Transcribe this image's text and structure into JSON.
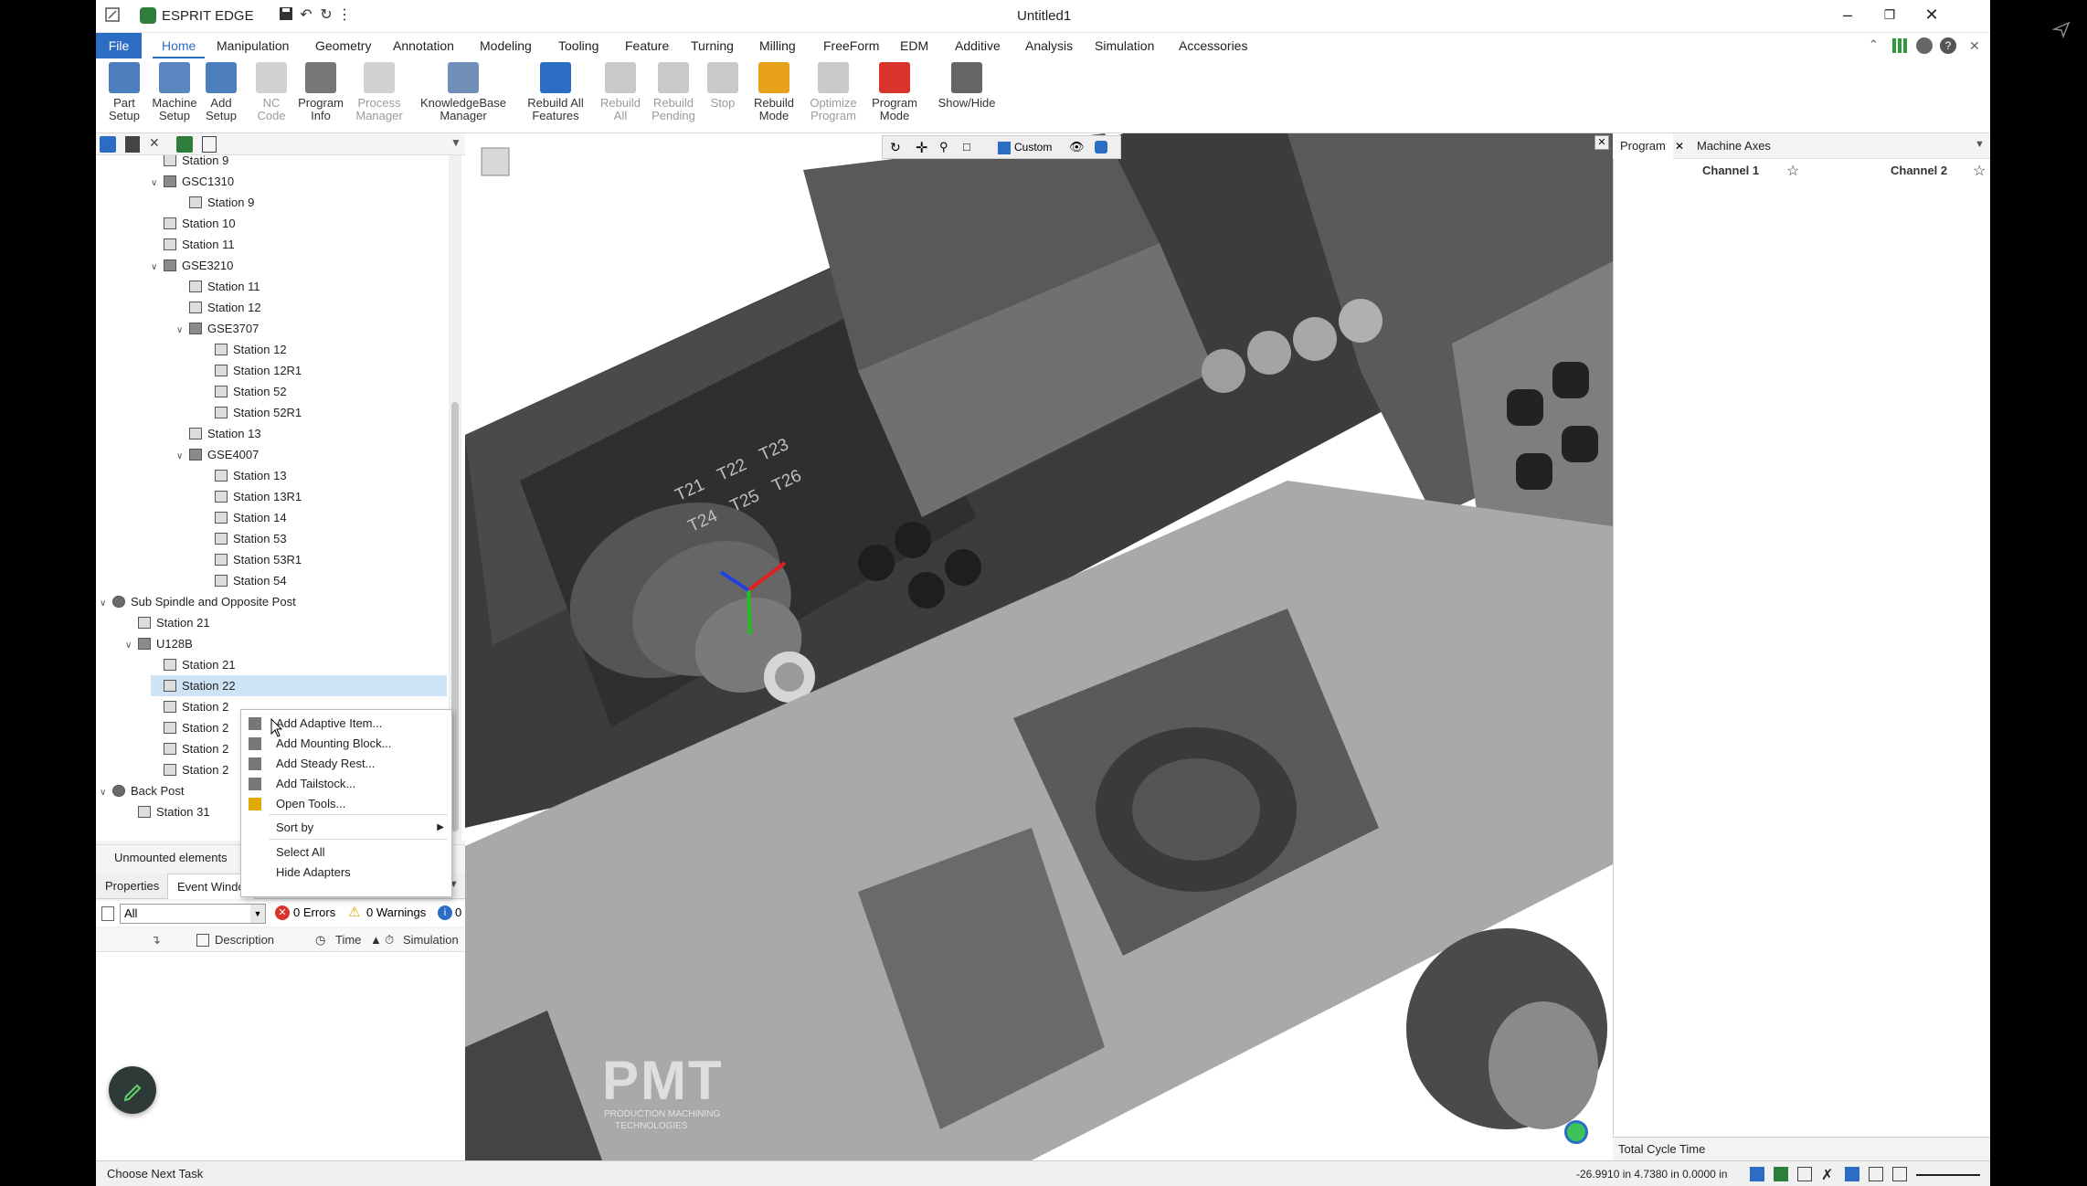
{
  "app": {
    "name": "ESPRIT EDGE",
    "document_title": "Untitled1"
  },
  "ribbon_tabs": [
    "File",
    "Home",
    "Manipulation",
    "Geometry",
    "Annotation",
    "Modeling",
    "Tooling",
    "Feature",
    "Turning",
    "Milling",
    "FreeForm",
    "EDM",
    "Additive",
    "Analysis",
    "Simulation",
    "Accessories"
  ],
  "active_tab": "Home",
  "ribbon_buttons": [
    {
      "line1": "Part",
      "line2": "Setup",
      "enabled": true,
      "icon": "part-setup-icon"
    },
    {
      "line1": "Machine",
      "line2": "Setup",
      "enabled": true,
      "icon": "machine-setup-icon"
    },
    {
      "line1": "Add",
      "line2": "Setup",
      "enabled": true,
      "icon": "add-setup-icon"
    },
    {
      "line1": "NC",
      "line2": "Code",
      "enabled": false,
      "icon": "nc-code-icon"
    },
    {
      "line1": "Program",
      "line2": "Info",
      "enabled": true,
      "icon": "program-info-icon"
    },
    {
      "line1": "Process",
      "line2": "Manager",
      "enabled": false,
      "icon": "process-manager-icon"
    },
    {
      "line1": "KnowledgeBase",
      "line2": "Manager",
      "enabled": true,
      "icon": "knowledgebase-icon"
    },
    {
      "line1": "Rebuild All",
      "line2": "Features",
      "enabled": true,
      "icon": "rebuild-all-features-icon"
    },
    {
      "line1": "Rebuild",
      "line2": "All",
      "enabled": false,
      "icon": "rebuild-all-icon"
    },
    {
      "line1": "Rebuild",
      "line2": "Pending",
      "enabled": false,
      "icon": "rebuild-pending-icon"
    },
    {
      "line1": "Stop",
      "line2": "",
      "enabled": false,
      "icon": "stop-icon"
    },
    {
      "line1": "Rebuild",
      "line2": "Mode",
      "enabled": true,
      "icon": "rebuild-mode-icon"
    },
    {
      "line1": "Optimize",
      "line2": "Program",
      "enabled": false,
      "icon": "optimize-program-icon"
    },
    {
      "line1": "Program",
      "line2": "Mode",
      "enabled": true,
      "icon": "program-mode-icon"
    },
    {
      "line1": "Show/Hide",
      "line2": "",
      "enabled": true,
      "icon": "show-hide-icon"
    }
  ],
  "tree": {
    "nodes": [
      {
        "label": "Station 9",
        "level": 2,
        "chev": "",
        "type": "station"
      },
      {
        "label": "GSC1310",
        "level": 2,
        "chev": "v",
        "type": "adapter"
      },
      {
        "label": "Station 9",
        "level": 3,
        "chev": "",
        "type": "station"
      },
      {
        "label": "Station 10",
        "level": 2,
        "chev": "",
        "type": "station"
      },
      {
        "label": "Station 11",
        "level": 2,
        "chev": "",
        "type": "station"
      },
      {
        "label": "GSE3210",
        "level": 2,
        "chev": "v",
        "type": "adapter"
      },
      {
        "label": "Station 11",
        "level": 3,
        "chev": "",
        "type": "station"
      },
      {
        "label": "Station 12",
        "level": 3,
        "chev": "",
        "type": "station"
      },
      {
        "label": "GSE3707",
        "level": 3,
        "chev": "v",
        "type": "adapter"
      },
      {
        "label": "Station 12",
        "level": 4,
        "chev": "",
        "type": "station"
      },
      {
        "label": "Station 12R1",
        "level": 4,
        "chev": "",
        "type": "station"
      },
      {
        "label": "Station 52",
        "level": 4,
        "chev": "",
        "type": "station"
      },
      {
        "label": "Station 52R1",
        "level": 4,
        "chev": "",
        "type": "station"
      },
      {
        "label": "Station 13",
        "level": 3,
        "chev": "",
        "type": "station"
      },
      {
        "label": "GSE4007",
        "level": 3,
        "chev": "v",
        "type": "adapter"
      },
      {
        "label": "Station 13",
        "level": 4,
        "chev": "",
        "type": "station"
      },
      {
        "label": "Station 13R1",
        "level": 4,
        "chev": "",
        "type": "station"
      },
      {
        "label": "Station 14",
        "level": 4,
        "chev": "",
        "type": "station"
      },
      {
        "label": "Station 53",
        "level": 4,
        "chev": "",
        "type": "station"
      },
      {
        "label": "Station 53R1",
        "level": 4,
        "chev": "",
        "type": "station"
      },
      {
        "label": "Station 54",
        "level": 4,
        "chev": "",
        "type": "station"
      },
      {
        "label": "Sub Spindle and Opposite Post",
        "level": 0,
        "chev": "v",
        "type": "post"
      },
      {
        "label": "Station 21",
        "level": 1,
        "chev": "",
        "type": "station"
      },
      {
        "label": "U128B",
        "level": 1,
        "chev": "v",
        "type": "adapter"
      },
      {
        "label": "Station 21",
        "level": 2,
        "chev": "",
        "type": "station"
      },
      {
        "label": "Station 22",
        "level": 2,
        "chev": "",
        "type": "station",
        "selected": true
      },
      {
        "label": "Station 2",
        "level": 2,
        "chev": "",
        "type": "station"
      },
      {
        "label": "Station 2",
        "level": 2,
        "chev": "",
        "type": "station"
      },
      {
        "label": "Station 2",
        "level": 2,
        "chev": "",
        "type": "station"
      },
      {
        "label": "Station 2",
        "level": 2,
        "chev": "",
        "type": "station"
      },
      {
        "label": "Back Post",
        "level": 0,
        "chev": "v",
        "type": "post"
      },
      {
        "label": "Station 31",
        "level": 1,
        "chev": "",
        "type": "station"
      }
    ]
  },
  "unmounted_label": "Unmounted elements",
  "bottom_tabs": [
    "Properties",
    "Event Windo"
  ],
  "filter": {
    "value": "All",
    "errors": "0 Errors",
    "warnings": "0 Warnings",
    "info": "0"
  },
  "event_columns": [
    "Description",
    "Time",
    "Simulation"
  ],
  "context_menu": {
    "items": [
      {
        "label": "Add Adaptive Item...",
        "icon": "adaptive-item-icon"
      },
      {
        "label": "Add Mounting Block...",
        "icon": "mounting-block-icon"
      },
      {
        "label": "Add Steady Rest...",
        "icon": "steady-rest-icon"
      },
      {
        "label": "Add Tailstock...",
        "icon": "tailstock-icon"
      },
      {
        "label": "Open Tools...",
        "icon": "open-tools-icon"
      },
      {
        "label": "Sort by",
        "icon": "",
        "submenu": true
      },
      {
        "label": "Select All",
        "icon": ""
      },
      {
        "label": "Hide Adapters",
        "icon": ""
      }
    ]
  },
  "viewport": {
    "view_mode": "Custom",
    "turret_labels": [
      "T21",
      "T22",
      "T23",
      "T24",
      "T25",
      "T26"
    ],
    "watermark_main": "PMT",
    "watermark_sub1": "PRODUCTION MACHINING",
    "watermark_sub2": "TECHNOLOGIES"
  },
  "right_panel": {
    "tabs": [
      "Program",
      "Machine Axes"
    ],
    "channels": [
      "Channel 1",
      "Channel 2"
    ],
    "total_cycle_time_label": "Total Cycle Time"
  },
  "status": {
    "task": "Choose Next Task",
    "coords": "-26.9910 in  4.7380 in  0.0000 in"
  },
  "colors": {
    "accent": "#2b6cc4",
    "selection": "#cfe3f7",
    "machine_dark": "#3a3a3a",
    "machine_mid": "#6e6e6e",
    "machine_light": "#a8a8a8"
  }
}
